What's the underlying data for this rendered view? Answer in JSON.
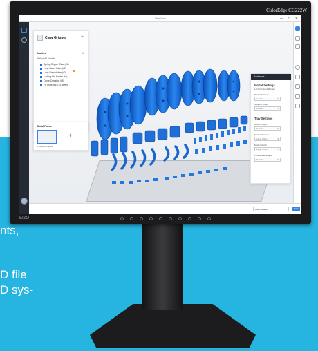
{
  "background_text": {
    "line1": "nts,",
    "line2": "D file",
    "line3": "D sys-"
  },
  "monitor": {
    "brand": "ColorEdge CG222W",
    "bezel_logo": "EIZO"
  },
  "app": {
    "window_title": "PreForm",
    "window_controls": [
      "—",
      "□",
      "✕"
    ],
    "left_panel": {
      "title": "Claw Gripper",
      "add_label": "+",
      "models_label": "Models",
      "models_count": "8",
      "select_all": "Select All Models",
      "models": [
        "Spring Gripper Claw (#1)",
        "Long Claw Holder (#2)",
        "Long Claw Holder (#3)",
        "Locking Pin Holder (#4)",
        "Curve Crossbar (#5)",
        "Fix Plate (#6) (22 layers)"
      ]
    },
    "build_plates": {
      "title": "Build Plates",
      "add_label": "+",
      "caption": "1 Build Complete"
    },
    "right_panel": {
      "header": "Materials",
      "model_settings": "Model Settings",
      "model_settings_sub": "Let's Chained Models",
      "sections": [
        {
          "label": "Print OK Range",
          "value": "1.0 Fine"
        },
        {
          "label": "Support Offset",
          "value": "Default"
        }
      ],
      "tray_settings": "Tray Settings",
      "tray_fields": [
        {
          "label": "Model Height",
          "value": "Default"
        },
        {
          "label": "Model Distance",
          "value": "Large Offset"
        },
        {
          "label": "Model Depth",
          "value": "Large Offset"
        },
        {
          "label": "Print Bottle Shape",
          "value": "Default"
        }
      ]
    },
    "bottom_bar": {
      "field_value": "Build Cleaner",
      "button_label": "Print"
    }
  }
}
